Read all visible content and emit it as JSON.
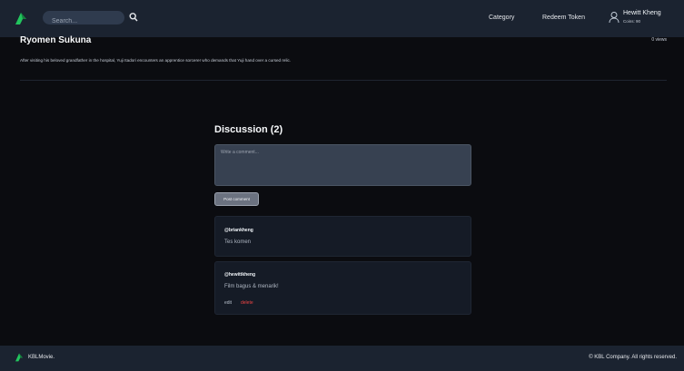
{
  "navbar": {
    "search": {
      "placeholder": "Search..."
    },
    "links": {
      "category": "Category",
      "redeem": "Redeem Token"
    },
    "user": {
      "name": "Hewitt Kheng",
      "coins": "Coins: 90"
    },
    "icons": {
      "logo": "kbl-logo-icon",
      "search": "search-icon",
      "user": "user-icon"
    }
  },
  "movie": {
    "title": "Ryomen Sukuna",
    "views": "0 views",
    "synopsis": "After visiting his beloved grandfather in the hospital, Yuji Itadori encounters an apprentice sorcerer who demands that Yuji hand over a cursed relic."
  },
  "discussion": {
    "title": "Discussion (2)",
    "comment_placeholder": "Write a comment...",
    "post_label": "Post comment",
    "comments": [
      {
        "user": "@briankheng",
        "text": "Tes komen"
      },
      {
        "user": "@hewittkheng",
        "text": "Film bagus & menarik!",
        "edit_label": "edit",
        "delete_label": "delete"
      }
    ]
  },
  "footer": {
    "brand": "KBLMovie.",
    "copyright": "© KBL Company. All rights reserved."
  },
  "colors": {
    "navbar_bg": "#1b2330",
    "page_bg": "#0b0c10",
    "logo_green": "#22c55e",
    "delete_red": "#ef4444"
  }
}
